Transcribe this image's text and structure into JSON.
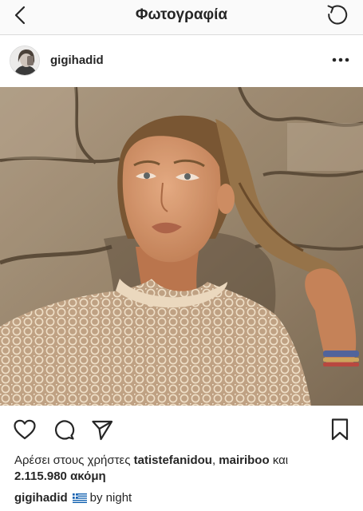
{
  "nav": {
    "title": "Φωτογραφία",
    "back_icon": "chevron-left-icon",
    "refresh_icon": "refresh-icon"
  },
  "post": {
    "username": "gigihadid",
    "more_icon": "ellipsis-icon",
    "likes": {
      "prefix": "Αρέσει στους χρήστες",
      "user1": "tatistefanidou",
      "separator": ",",
      "user2": "mairiboo",
      "conjunction": "και",
      "count": "2.115.980",
      "suffix": "ακόμη"
    },
    "caption": {
      "username": "gigihadid",
      "flag": "greece-flag",
      "text": "by night"
    }
  },
  "colors": {
    "text": "#262626",
    "border": "#dbdbdb",
    "background": "#ffffff"
  }
}
